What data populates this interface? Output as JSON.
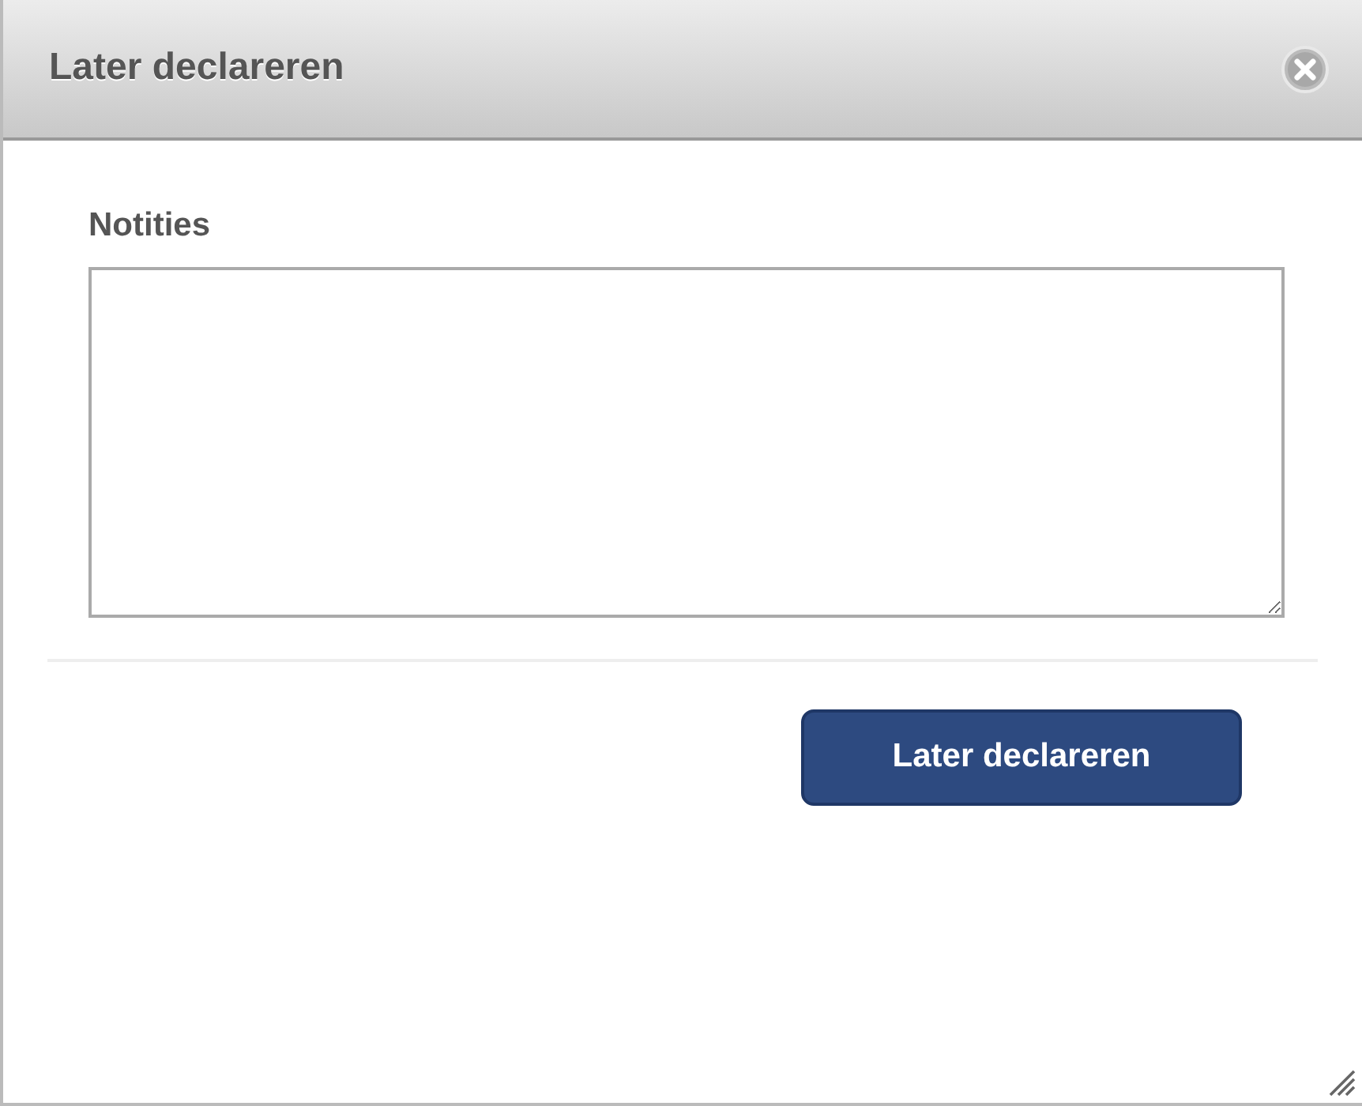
{
  "dialog": {
    "title": "Later declareren"
  },
  "notes": {
    "label": "Notities"
  },
  "buttons": [
    {
      "label": "Later declareren",
      "kind": "primary"
    }
  ]
}
